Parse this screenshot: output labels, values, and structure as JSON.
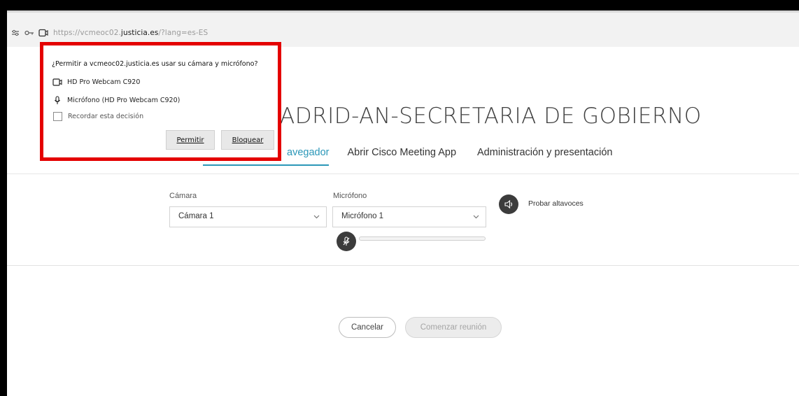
{
  "browser": {
    "url_prefix": "https://vcmeoc02.",
    "url_host": "justicia.es",
    "url_suffix": "/?lang=es-ES",
    "icons": [
      "permissions-icon",
      "key-icon",
      "camera-indicator-icon"
    ]
  },
  "permission_popup": {
    "question": "¿Permitir a vcmeoc02.justicia.es usar su cámara y micrófono?",
    "camera_device": "HD Pro Webcam C920",
    "mic_device": "Micrófono (HD Pro Webcam C920)",
    "remember_label": "Recordar esta decisión",
    "remember_checked": false,
    "allow_label": "Permitir",
    "block_label": "Bloquear"
  },
  "page": {
    "title": "ADRID-AN-SECRETARIA DE GOBIERNO",
    "tabs": [
      {
        "label": "avegador",
        "active": true
      },
      {
        "label": "Abrir Cisco Meeting App",
        "active": false
      },
      {
        "label": "Administración y presentación",
        "active": false
      }
    ],
    "camera": {
      "label": "Cámara",
      "selected": "Cámara 1"
    },
    "microphone": {
      "label": "Micrófono",
      "selected": "Micrófono 1",
      "level": 0
    },
    "speaker_test_label": "Probar altavoces",
    "cancel_label": "Cancelar",
    "start_label": "Comenzar reunión"
  },
  "colors": {
    "accent": "#2b97b8",
    "highlight_border": "#e40000"
  }
}
